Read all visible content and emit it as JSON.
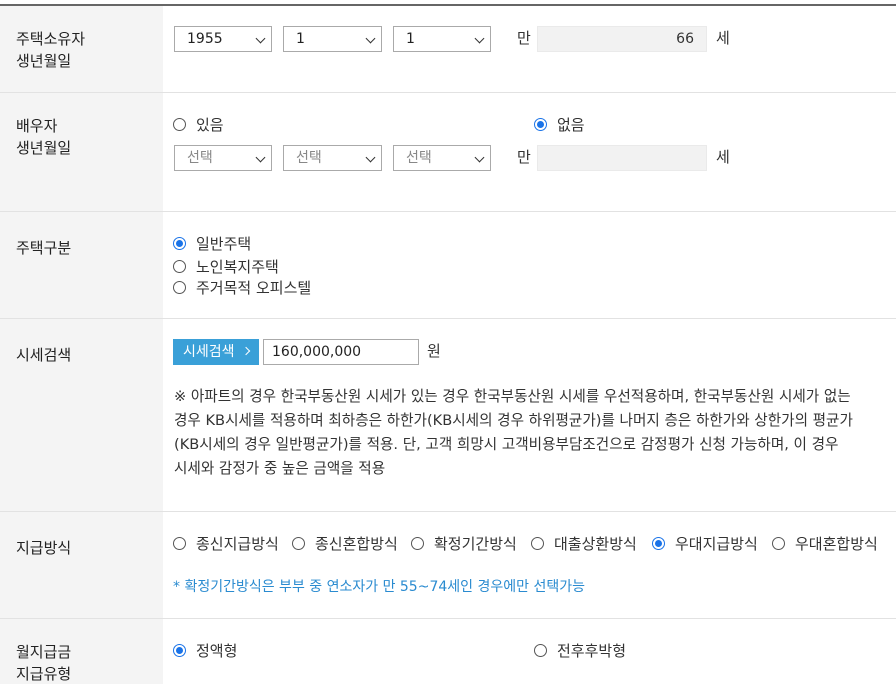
{
  "owner_birth": {
    "label_line1": "주택소유자",
    "label_line2": "생년월일",
    "year": "1955",
    "month": "1",
    "day": "1",
    "age_prefix": "만",
    "age_value": "66",
    "age_suffix": "세"
  },
  "spouse_birth": {
    "label_line1": "배우자",
    "label_line2": "생년월일",
    "option_yes": "있음",
    "option_no": "없음",
    "selected": "없음",
    "year_placeholder": "선택",
    "month_placeholder": "선택",
    "day_placeholder": "선택",
    "age_prefix": "만",
    "age_value": "",
    "age_suffix": "세"
  },
  "house_type": {
    "label": "주택구분",
    "options": [
      "일반주택",
      "노인복지주택",
      "주거목적 오피스텔"
    ],
    "selected": "일반주택"
  },
  "price_search": {
    "label": "시세검색",
    "button_label": "시세검색",
    "value": "160,000,000",
    "unit": "원",
    "notice_line1": "※ 아파트의 경우 한국부동산원 시세가 있는 경우 한국부동산원 시세를 우선적용하며, 한국부동산원 시세가 없는",
    "notice_line2": "경우 KB시세를 적용하며 최하층은 하한가(KB시세의 경우 하위평균가)를 나머지 층은 하한가와 상한가의 평균가",
    "notice_line3": "(KB시세의 경우 일반평균가)를 적용. 단, 고객 희망시 고객비용부담조건으로 감정평가 신청 가능하며, 이 경우",
    "notice_line4": "시세와 감정가 중 높은 금액을 적용"
  },
  "payment_method": {
    "label": "지급방식",
    "options": [
      "종신지급방식",
      "종신혼합방식",
      "확정기간방식",
      "대출상환방식",
      "우대지급방식",
      "우대혼합방식"
    ],
    "selected": "우대지급방식",
    "note": "* 확정기간방식은 부부 중 연소자가 만 55~74세인 경우에만 선택가능"
  },
  "monthly_type": {
    "label_line1": "월지급금",
    "label_line2": "지급유형",
    "option_fixed": "정액형",
    "option_front": "전후후박형",
    "selected": "정액형"
  },
  "colors": {
    "accent": "#1a73e8",
    "button": "#3aa0d8",
    "note": "#2a8bd0",
    "label_bg": "#f4f4f4"
  }
}
